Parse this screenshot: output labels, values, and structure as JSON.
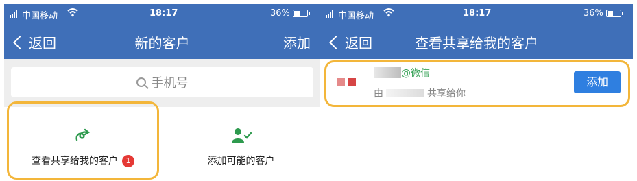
{
  "left_screen": {
    "status": {
      "carrier": "中国移动",
      "time": "18:17",
      "battery": "36%"
    },
    "nav": {
      "back": "返回",
      "title": "新的客户",
      "action": "添加"
    },
    "search": {
      "placeholder": "手机号"
    },
    "tiles": [
      {
        "label": "查看共享给我的客户",
        "badge": "1",
        "icon": "share-swirl-icon"
      },
      {
        "label": "添加可能的客户",
        "icon": "add-user-check-icon"
      }
    ]
  },
  "right_screen": {
    "status": {
      "carrier": "中国移动",
      "time": "18:17",
      "battery": "36%"
    },
    "nav": {
      "back": "返回",
      "title": "查看共享给我的客户"
    },
    "item": {
      "tag": "@微信",
      "shared_prefix": "由",
      "shared_suffix": "共享给你",
      "button": "添加"
    }
  },
  "colors": {
    "header": "#3f6fb8",
    "highlight": "#f3b63a",
    "green": "#2e9a4e",
    "button": "#2f7fe0",
    "badge": "#e53935"
  }
}
